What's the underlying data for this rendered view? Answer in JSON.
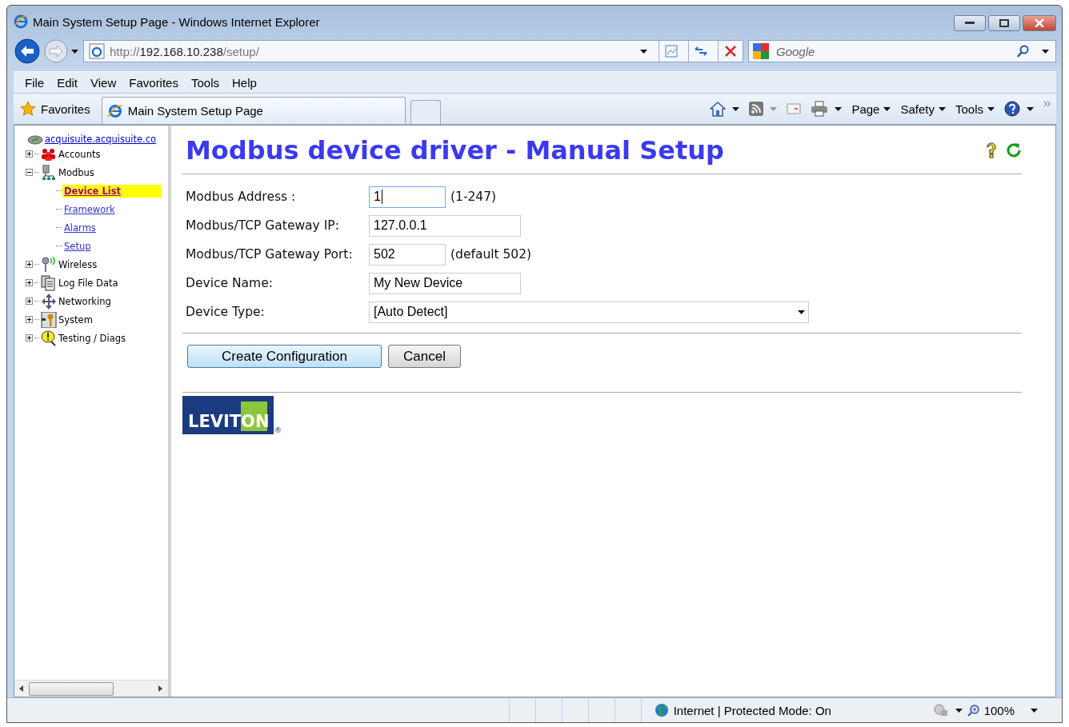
{
  "window": {
    "title": "Main System Setup Page - Windows Internet Explorer"
  },
  "address_bar": {
    "url_scheme": "http://",
    "url_host": "192.168.10.238",
    "url_path": "/setup/"
  },
  "search": {
    "placeholder": "Google"
  },
  "menu": [
    "File",
    "Edit",
    "View",
    "Favorites",
    "Tools",
    "Help"
  ],
  "favorites_bar": {
    "label": "Favorites",
    "tabs": [
      {
        "label": "Main System Setup Page",
        "selected": true
      }
    ]
  },
  "command_bar": [
    "Page",
    "Safety",
    "Tools"
  ],
  "tree": {
    "root": "acquisuite.acquisuite.co",
    "items": [
      {
        "label": "Accounts",
        "expanded": false
      },
      {
        "label": "Modbus",
        "expanded": true,
        "children": [
          {
            "label": "Device List",
            "selected": true
          },
          {
            "label": "Framework",
            "selected": false
          },
          {
            "label": "Alarms",
            "selected": false
          },
          {
            "label": "Setup",
            "selected": false
          }
        ]
      },
      {
        "label": "Wireless",
        "expanded": false
      },
      {
        "label": "Log File Data",
        "expanded": false
      },
      {
        "label": "Networking",
        "expanded": false
      },
      {
        "label": "System",
        "expanded": false
      },
      {
        "label": "Testing / Diags",
        "expanded": false
      }
    ]
  },
  "page": {
    "heading": "Modbus device driver - Manual Setup",
    "fields": [
      {
        "kind": "text",
        "label": "Modbus Address :",
        "value": "1",
        "hint": "(1-247)",
        "focused": true
      },
      {
        "kind": "text",
        "label": "Modbus/TCP Gateway IP:",
        "value": "127.0.0.1",
        "focused": false
      },
      {
        "kind": "text",
        "label": "Modbus/TCP Gateway Port:",
        "value": "502",
        "hint": "(default 502)",
        "focused": false
      },
      {
        "kind": "text",
        "label": "Device Name:",
        "value": "My New Device",
        "focused": false
      },
      {
        "kind": "select",
        "label": "Device Type:",
        "value": "[Auto Detect]"
      }
    ],
    "buttons": [
      {
        "label": "Create Configuration",
        "primary": true
      },
      {
        "label": "Cancel",
        "primary": false
      }
    ],
    "logo": {
      "text": "LEVITON",
      "mark": "®"
    }
  },
  "status_bar": {
    "zone": "Internet | Protected Mode: On",
    "zoom": "100%"
  }
}
